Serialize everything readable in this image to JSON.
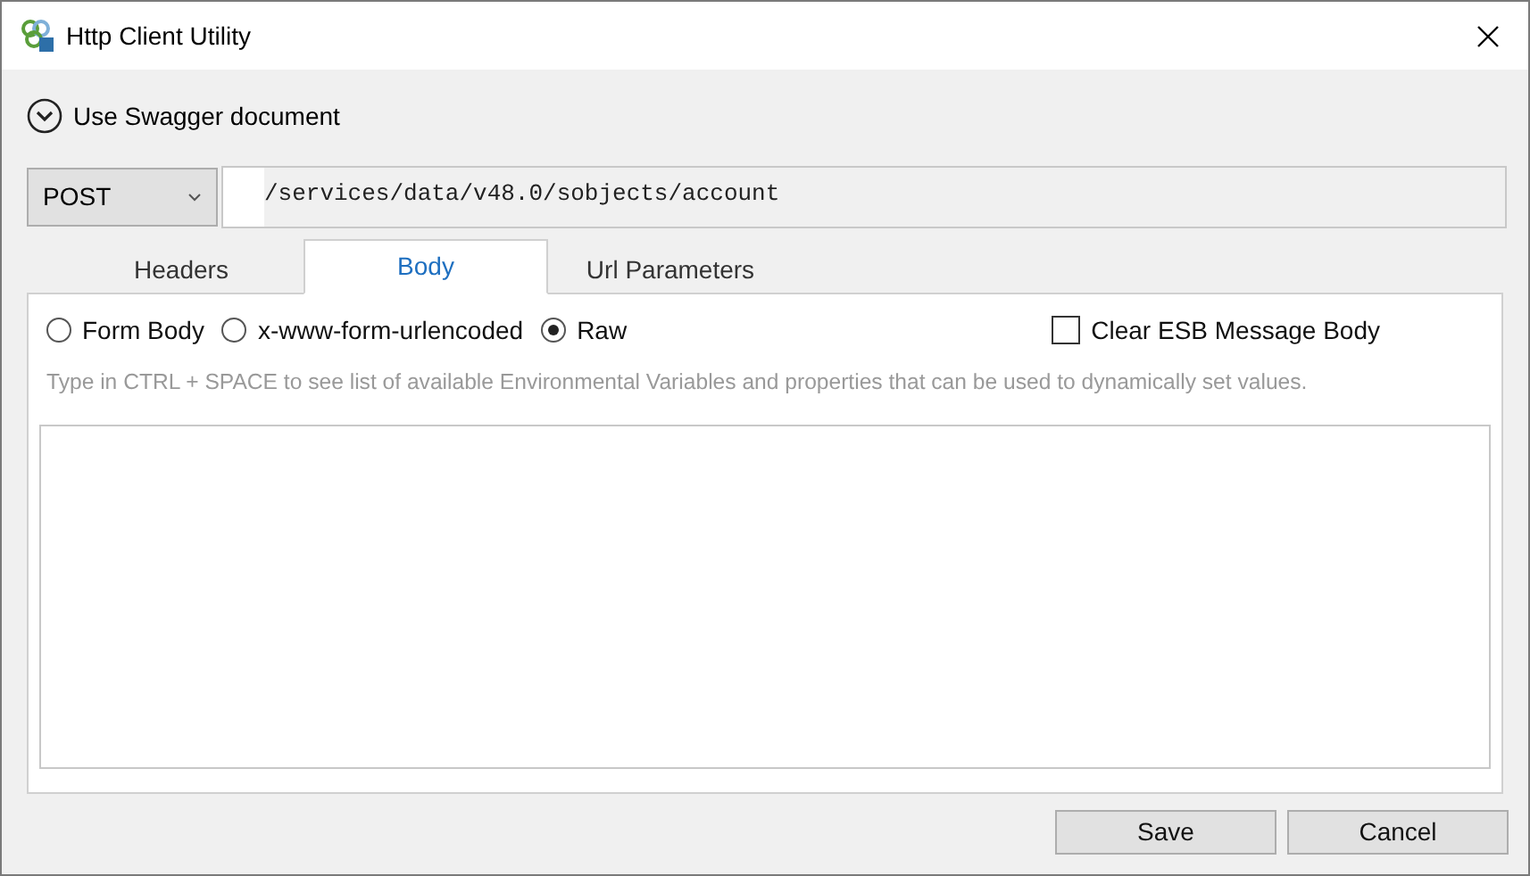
{
  "window": {
    "title": "Http Client Utility"
  },
  "swagger": {
    "label": "Use Swagger document",
    "expanded": false
  },
  "method": {
    "value": "POST"
  },
  "url": {
    "value": "/services/data/v48.0/sobjects/account"
  },
  "tabs": [
    {
      "label": "Headers",
      "selected": false
    },
    {
      "label": "Body",
      "selected": true
    },
    {
      "label": "Url Parameters",
      "selected": false
    }
  ],
  "body_types": [
    {
      "label": "Form Body",
      "selected": false
    },
    {
      "label": "x-www-form-urlencoded",
      "selected": false
    },
    {
      "label": "Raw",
      "selected": true
    }
  ],
  "clear_body": {
    "label": "Clear ESB Message Body",
    "checked": false
  },
  "hint": "Type in CTRL + SPACE to see list of available Environmental Variables and properties that can be used to dynamically set values.",
  "buttons": [
    "Save",
    "Cancel"
  ]
}
